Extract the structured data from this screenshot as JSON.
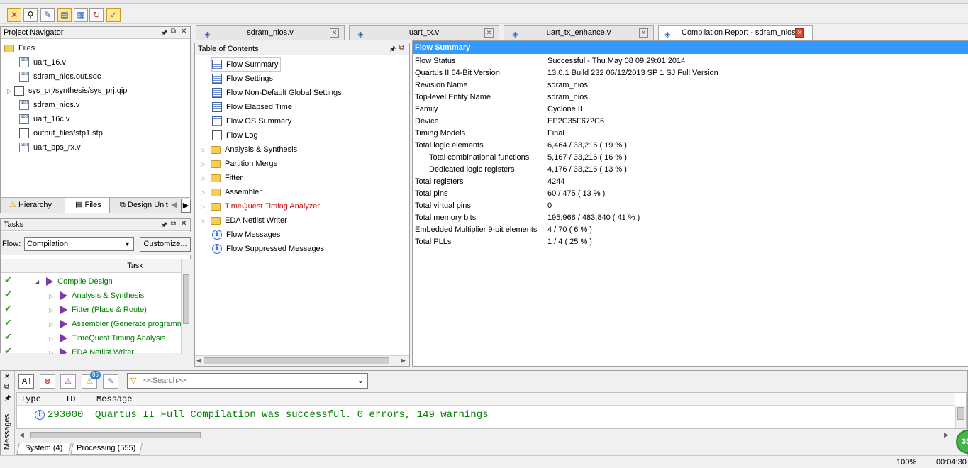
{
  "toolbar": {
    "icons": [
      "stop-icon",
      "binoculars-icon",
      "edit-icon",
      "flow-icon",
      "grid-icon",
      "refresh-icon",
      "check-icon"
    ]
  },
  "project_navigator": {
    "title": "Project Navigator",
    "root": "Files",
    "files": [
      "uart_16.v",
      "sdram_nios.out.sdc",
      "sys_prj/synthesis/sys_prj.qip",
      "sdram_nios.v",
      "uart_16c.v",
      "output_files/stp1.stp",
      "uart_bps_rx.v"
    ],
    "tabs": [
      "Hierarchy",
      "Files",
      "Design Unit"
    ]
  },
  "tasks": {
    "title": "Tasks",
    "flow_label": "Flow:",
    "flow_value": "Compilation",
    "customize_label": "Customize...",
    "column_header": "Task",
    "items": [
      "Compile Design",
      "Analysis & Synthesis",
      "Fitter (Place & Route)",
      "Assembler (Generate programm",
      "TimeQuest Timing Analysis",
      "EDA Netlist Writer"
    ]
  },
  "doc_tabs": [
    "sdram_nios.v",
    "uart_tx.v",
    "uart_tx_enhance.v",
    "Compilation Report - sdram_nios"
  ],
  "toc": {
    "title": "Table of Contents",
    "items": [
      "Flow Summary",
      "Flow Settings",
      "Flow Non-Default Global Settings",
      "Flow Elapsed Time",
      "Flow OS Summary",
      "Flow Log",
      "Analysis & Synthesis",
      "Partition Merge",
      "Fitter",
      "Assembler",
      "TimeQuest Timing Analyzer",
      "EDA Netlist Writer",
      "Flow Messages",
      "Flow Suppressed Messages"
    ]
  },
  "summary": {
    "title": "Flow Summary",
    "rows": [
      {
        "label": "Flow Status",
        "value": "Successful - Thu May 08 09:29:01 2014"
      },
      {
        "label": "Quartus II 64-Bit Version",
        "value": "13.0.1 Build 232 06/12/2013 SP 1 SJ Full Version"
      },
      {
        "label": "Revision Name",
        "value": "sdram_nios"
      },
      {
        "label": "Top-level Entity Name",
        "value": "sdram_nios"
      },
      {
        "label": "Family",
        "value": "Cyclone II"
      },
      {
        "label": "Device",
        "value": "EP2C35F672C6"
      },
      {
        "label": "Timing Models",
        "value": "Final"
      },
      {
        "label": "Total logic elements",
        "value": "6,464 / 33,216 ( 19 % )"
      },
      {
        "label": "Total combinational functions",
        "value": "5,167 / 33,216 ( 16 % )"
      },
      {
        "label": "Dedicated logic registers",
        "value": "4,176 / 33,216 ( 13 % )"
      },
      {
        "label": "Total registers",
        "value": "4244"
      },
      {
        "label": "Total pins",
        "value": "60 / 475 ( 13 % )"
      },
      {
        "label": "Total virtual pins",
        "value": "0"
      },
      {
        "label": "Total memory bits",
        "value": "195,968 / 483,840 ( 41 % )"
      },
      {
        "label": "Embedded Multiplier 9-bit elements",
        "value": "4 / 70 ( 6 % )"
      },
      {
        "label": "Total PLLs",
        "value": "1 / 4 ( 25 % )"
      }
    ]
  },
  "messages": {
    "side_label": "Messages",
    "all_label": "All",
    "warning_count": "85",
    "search_placeholder": "<<Search>>",
    "columns": [
      "Type",
      "ID",
      "Message"
    ],
    "row": {
      "id": "293000",
      "text": "Quartus II Full Compilation was successful. 0 errors, 149 warnings"
    },
    "tabs": [
      "System (4)",
      "Processing (555)"
    ]
  },
  "status": {
    "zoom": "100%",
    "time": "00:04:30",
    "progress_badge": "35"
  }
}
